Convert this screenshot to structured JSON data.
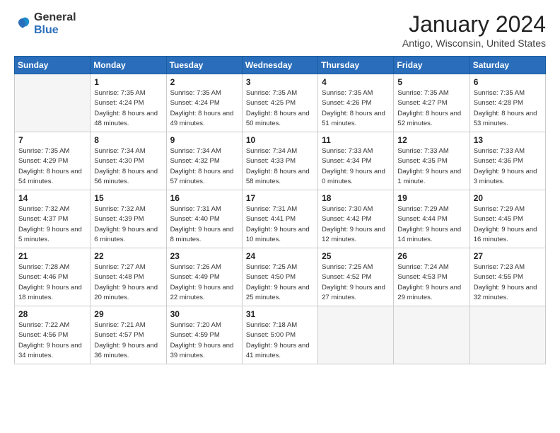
{
  "logo": {
    "general": "General",
    "blue": "Blue"
  },
  "header": {
    "month_year": "January 2024",
    "location": "Antigo, Wisconsin, United States"
  },
  "weekdays": [
    "Sunday",
    "Monday",
    "Tuesday",
    "Wednesday",
    "Thursday",
    "Friday",
    "Saturday"
  ],
  "weeks": [
    [
      {
        "day": "",
        "sunrise": "",
        "sunset": "",
        "daylight": ""
      },
      {
        "day": "1",
        "sunrise": "Sunrise: 7:35 AM",
        "sunset": "Sunset: 4:24 PM",
        "daylight": "Daylight: 8 hours and 48 minutes."
      },
      {
        "day": "2",
        "sunrise": "Sunrise: 7:35 AM",
        "sunset": "Sunset: 4:24 PM",
        "daylight": "Daylight: 8 hours and 49 minutes."
      },
      {
        "day": "3",
        "sunrise": "Sunrise: 7:35 AM",
        "sunset": "Sunset: 4:25 PM",
        "daylight": "Daylight: 8 hours and 50 minutes."
      },
      {
        "day": "4",
        "sunrise": "Sunrise: 7:35 AM",
        "sunset": "Sunset: 4:26 PM",
        "daylight": "Daylight: 8 hours and 51 minutes."
      },
      {
        "day": "5",
        "sunrise": "Sunrise: 7:35 AM",
        "sunset": "Sunset: 4:27 PM",
        "daylight": "Daylight: 8 hours and 52 minutes."
      },
      {
        "day": "6",
        "sunrise": "Sunrise: 7:35 AM",
        "sunset": "Sunset: 4:28 PM",
        "daylight": "Daylight: 8 hours and 53 minutes."
      }
    ],
    [
      {
        "day": "7",
        "sunrise": "Sunrise: 7:35 AM",
        "sunset": "Sunset: 4:29 PM",
        "daylight": "Daylight: 8 hours and 54 minutes."
      },
      {
        "day": "8",
        "sunrise": "Sunrise: 7:34 AM",
        "sunset": "Sunset: 4:30 PM",
        "daylight": "Daylight: 8 hours and 56 minutes."
      },
      {
        "day": "9",
        "sunrise": "Sunrise: 7:34 AM",
        "sunset": "Sunset: 4:32 PM",
        "daylight": "Daylight: 8 hours and 57 minutes."
      },
      {
        "day": "10",
        "sunrise": "Sunrise: 7:34 AM",
        "sunset": "Sunset: 4:33 PM",
        "daylight": "Daylight: 8 hours and 58 minutes."
      },
      {
        "day": "11",
        "sunrise": "Sunrise: 7:33 AM",
        "sunset": "Sunset: 4:34 PM",
        "daylight": "Daylight: 9 hours and 0 minutes."
      },
      {
        "day": "12",
        "sunrise": "Sunrise: 7:33 AM",
        "sunset": "Sunset: 4:35 PM",
        "daylight": "Daylight: 9 hours and 1 minute."
      },
      {
        "day": "13",
        "sunrise": "Sunrise: 7:33 AM",
        "sunset": "Sunset: 4:36 PM",
        "daylight": "Daylight: 9 hours and 3 minutes."
      }
    ],
    [
      {
        "day": "14",
        "sunrise": "Sunrise: 7:32 AM",
        "sunset": "Sunset: 4:37 PM",
        "daylight": "Daylight: 9 hours and 5 minutes."
      },
      {
        "day": "15",
        "sunrise": "Sunrise: 7:32 AM",
        "sunset": "Sunset: 4:39 PM",
        "daylight": "Daylight: 9 hours and 6 minutes."
      },
      {
        "day": "16",
        "sunrise": "Sunrise: 7:31 AM",
        "sunset": "Sunset: 4:40 PM",
        "daylight": "Daylight: 9 hours and 8 minutes."
      },
      {
        "day": "17",
        "sunrise": "Sunrise: 7:31 AM",
        "sunset": "Sunset: 4:41 PM",
        "daylight": "Daylight: 9 hours and 10 minutes."
      },
      {
        "day": "18",
        "sunrise": "Sunrise: 7:30 AM",
        "sunset": "Sunset: 4:42 PM",
        "daylight": "Daylight: 9 hours and 12 minutes."
      },
      {
        "day": "19",
        "sunrise": "Sunrise: 7:29 AM",
        "sunset": "Sunset: 4:44 PM",
        "daylight": "Daylight: 9 hours and 14 minutes."
      },
      {
        "day": "20",
        "sunrise": "Sunrise: 7:29 AM",
        "sunset": "Sunset: 4:45 PM",
        "daylight": "Daylight: 9 hours and 16 minutes."
      }
    ],
    [
      {
        "day": "21",
        "sunrise": "Sunrise: 7:28 AM",
        "sunset": "Sunset: 4:46 PM",
        "daylight": "Daylight: 9 hours and 18 minutes."
      },
      {
        "day": "22",
        "sunrise": "Sunrise: 7:27 AM",
        "sunset": "Sunset: 4:48 PM",
        "daylight": "Daylight: 9 hours and 20 minutes."
      },
      {
        "day": "23",
        "sunrise": "Sunrise: 7:26 AM",
        "sunset": "Sunset: 4:49 PM",
        "daylight": "Daylight: 9 hours and 22 minutes."
      },
      {
        "day": "24",
        "sunrise": "Sunrise: 7:25 AM",
        "sunset": "Sunset: 4:50 PM",
        "daylight": "Daylight: 9 hours and 25 minutes."
      },
      {
        "day": "25",
        "sunrise": "Sunrise: 7:25 AM",
        "sunset": "Sunset: 4:52 PM",
        "daylight": "Daylight: 9 hours and 27 minutes."
      },
      {
        "day": "26",
        "sunrise": "Sunrise: 7:24 AM",
        "sunset": "Sunset: 4:53 PM",
        "daylight": "Daylight: 9 hours and 29 minutes."
      },
      {
        "day": "27",
        "sunrise": "Sunrise: 7:23 AM",
        "sunset": "Sunset: 4:55 PM",
        "daylight": "Daylight: 9 hours and 32 minutes."
      }
    ],
    [
      {
        "day": "28",
        "sunrise": "Sunrise: 7:22 AM",
        "sunset": "Sunset: 4:56 PM",
        "daylight": "Daylight: 9 hours and 34 minutes."
      },
      {
        "day": "29",
        "sunrise": "Sunrise: 7:21 AM",
        "sunset": "Sunset: 4:57 PM",
        "daylight": "Daylight: 9 hours and 36 minutes."
      },
      {
        "day": "30",
        "sunrise": "Sunrise: 7:20 AM",
        "sunset": "Sunset: 4:59 PM",
        "daylight": "Daylight: 9 hours and 39 minutes."
      },
      {
        "day": "31",
        "sunrise": "Sunrise: 7:18 AM",
        "sunset": "Sunset: 5:00 PM",
        "daylight": "Daylight: 9 hours and 41 minutes."
      },
      {
        "day": "",
        "sunrise": "",
        "sunset": "",
        "daylight": ""
      },
      {
        "day": "",
        "sunrise": "",
        "sunset": "",
        "daylight": ""
      },
      {
        "day": "",
        "sunrise": "",
        "sunset": "",
        "daylight": ""
      }
    ]
  ]
}
